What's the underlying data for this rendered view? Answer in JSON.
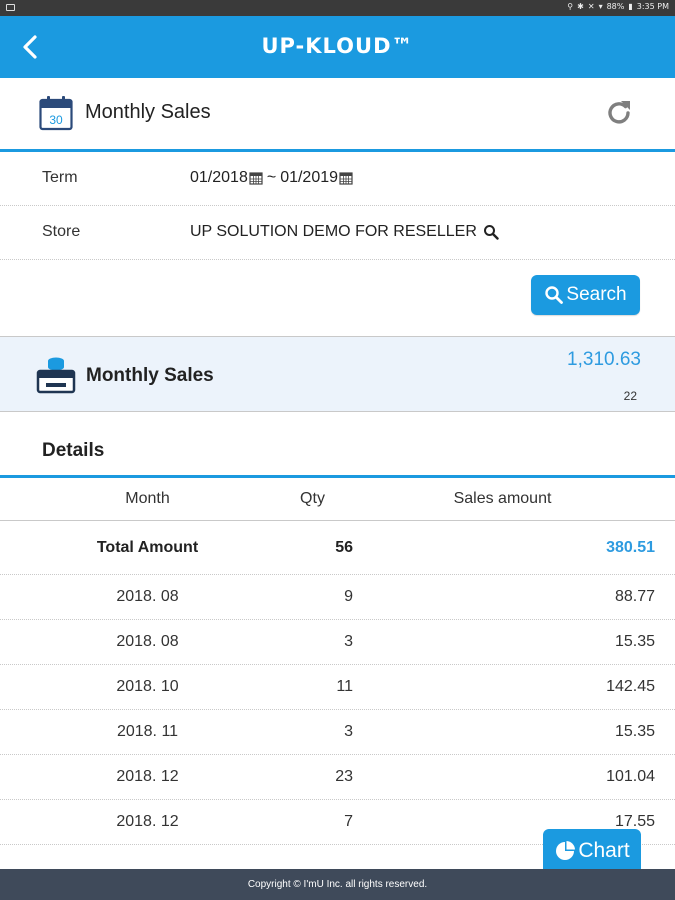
{
  "status_bar": {
    "battery": "88%",
    "time": "3:35 PM"
  },
  "app_bar": {
    "title": "UP-KLOUD™"
  },
  "page": {
    "title": "Monthly Sales",
    "calendar_day": "30"
  },
  "filters": {
    "term_label": "Term",
    "term_from": "01/2018",
    "term_separator": "~",
    "term_to": "01/2019",
    "store_label": "Store",
    "store_value": "UP SOLUTION DEMO FOR RESELLER"
  },
  "search_button": {
    "label": "Search"
  },
  "summary": {
    "title": "Monthly Sales",
    "amount": "1,310.63",
    "count": "22"
  },
  "details": {
    "title": "Details",
    "columns": [
      "Month",
      "Qty",
      "Sales amount"
    ],
    "total": {
      "label": "Total Amount",
      "qty": "56",
      "amount": "380.51"
    },
    "rows": [
      {
        "month": "2018. 08",
        "qty": "9",
        "amount": "88.77"
      },
      {
        "month": "2018. 08",
        "qty": "3",
        "amount": "15.35"
      },
      {
        "month": "2018. 10",
        "qty": "11",
        "amount": "142.45"
      },
      {
        "month": "2018. 11",
        "qty": "3",
        "amount": "15.35"
      },
      {
        "month": "2018. 12",
        "qty": "23",
        "amount": "101.04"
      },
      {
        "month": "2018. 12",
        "qty": "7",
        "amount": "17.55"
      }
    ]
  },
  "chart_button": {
    "label": "Chart"
  },
  "footer": {
    "copyright": "Copyright © I'mU Inc. all rights reserved."
  },
  "colors": {
    "accent": "#1b9ae0",
    "amount_blue": "#2e9be0",
    "footer_bg": "#3f4a5a"
  }
}
